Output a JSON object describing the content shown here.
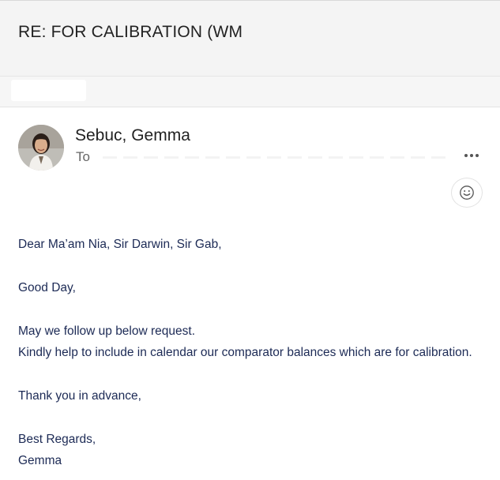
{
  "email": {
    "subject": "RE: FOR CALIBRATION (WM",
    "sender_name": "Sebuc, Gemma",
    "to_label": "To"
  },
  "icons": {
    "more": "more-horizontal-icon",
    "react": "smiley-face-icon",
    "avatar": "sender-avatar-photo"
  },
  "body": {
    "greeting": "Dear Ma’am Nia, Sir Darwin, Sir Gab,",
    "salutation": "Good Day,",
    "line1": "May we follow up below request.",
    "line2": "Kindly help to include in calendar our comparator balances which are for calibration.",
    "thanks": "Thank you in advance,",
    "closing": "Best Regards,",
    "signature": "Gemma"
  },
  "colors": {
    "body_text": "#1c2a55",
    "header_bg": "#f4f4f4"
  }
}
